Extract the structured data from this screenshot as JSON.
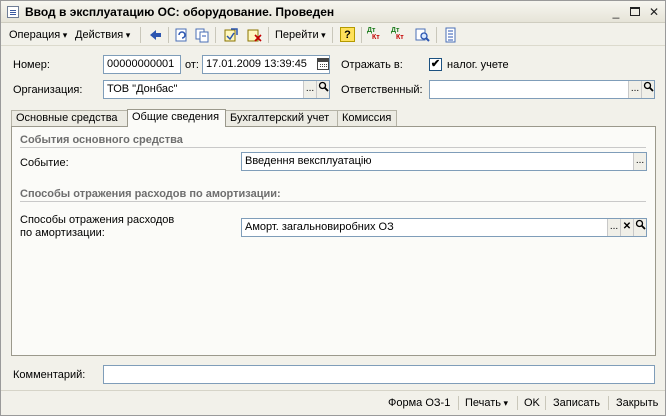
{
  "window": {
    "title": "Ввод в эксплуатацию ОС: оборудование. Проведен",
    "min_glyph": "_",
    "close_glyph": "✕"
  },
  "toolbar": {
    "operation_label": "Операция",
    "actions_label": "Действия",
    "goto_label": "Перейти",
    "help_label": "?",
    "dt_label": "Дт",
    "kt_label": "Кт",
    "dtn_label": "Дт",
    "ktn_label": "Кт"
  },
  "form": {
    "number_label": "Номер:",
    "number_value": "00000000001",
    "date_label": "от:",
    "date_value": "17.01.2009 13:39:45",
    "reflect_label": "Отражать в:",
    "tax_checkbox_label": "налог. учете",
    "tax_checked": true,
    "check_glyph": "✔",
    "org_label": "Организация:",
    "org_value": "ТОВ \"Донбас\"",
    "responsible_label": "Ответственный:",
    "responsible_value": "",
    "ellipsis": "...",
    "clear_glyph": "✕"
  },
  "tabs": [
    {
      "label": "Основные средства"
    },
    {
      "label": "Общие сведения",
      "active": true
    },
    {
      "label": "Бухгалтерский учет"
    },
    {
      "label": "Комиссия"
    }
  ],
  "general": {
    "events_title": "События основного средства",
    "event_label": "Событие:",
    "event_value": "Введення вексплуатацію",
    "amort_title": "Способы отражения расходов по амортизации:",
    "amort_label_line1": "Способы отражения расходов",
    "amort_label_line2": "по амортизации:",
    "amort_value": "Аморт. загальновиробних ОЗ"
  },
  "comment": {
    "label": "Комментарий:",
    "value": ""
  },
  "bottom": {
    "form_label": "Форма ОЗ-1",
    "print_label": "Печать",
    "ok_label": "OK",
    "save_label": "Записать",
    "close_label": "Закрыть"
  },
  "colors": {
    "window_bg": "#f2f1ea",
    "field_border": "#7f9db9",
    "group_title": "#6e6e6e"
  }
}
